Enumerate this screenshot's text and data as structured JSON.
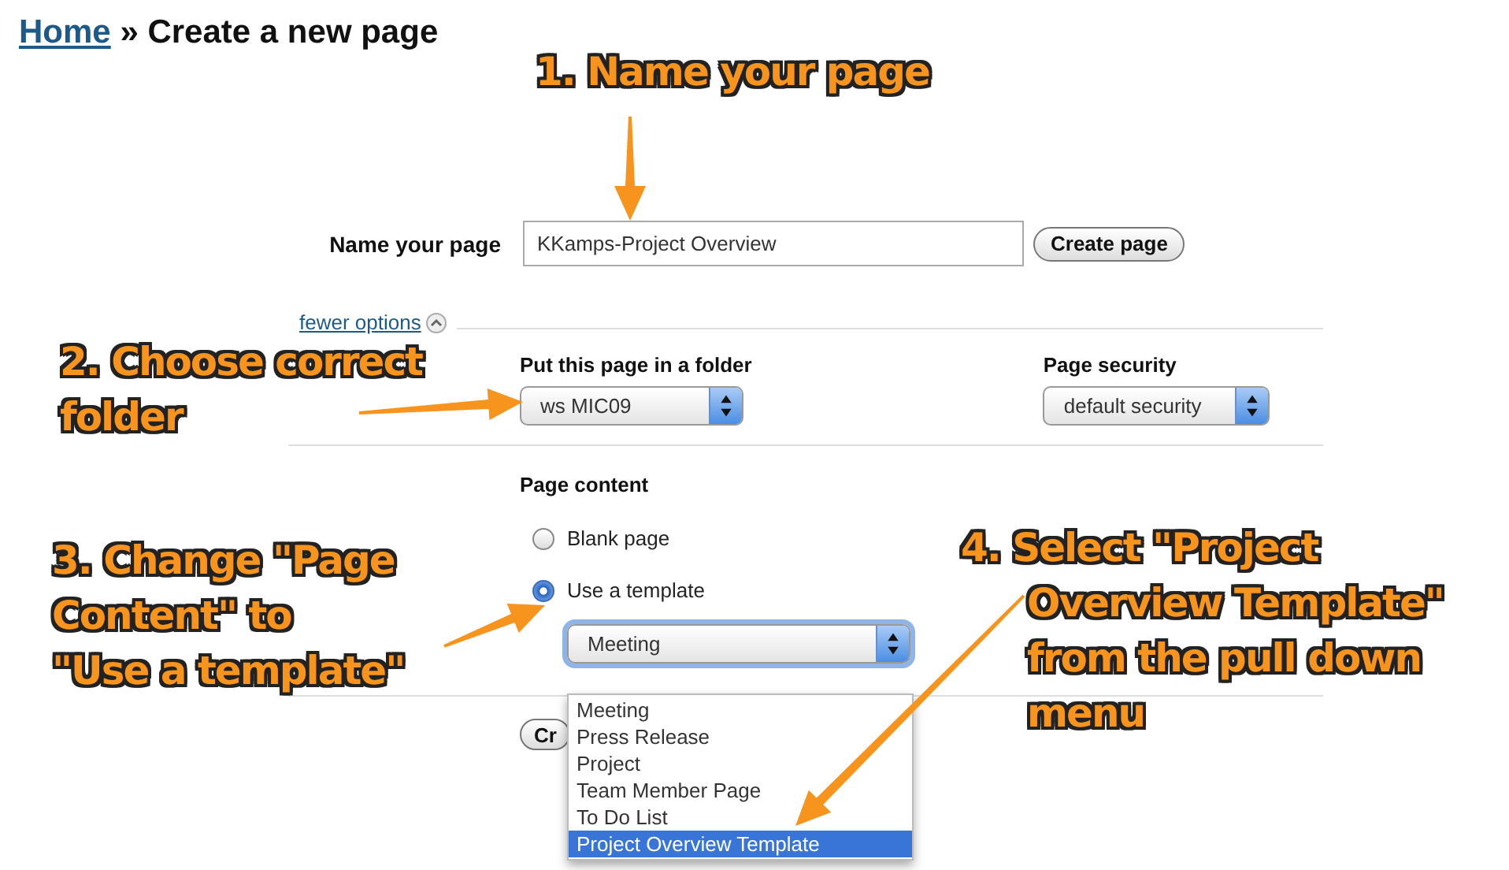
{
  "breadcrumb": {
    "link": "Home",
    "separator": "»",
    "current": "Create a new page"
  },
  "name_field": {
    "label": "Name your page",
    "value": "KKamps-Project Overview",
    "button": "Create page"
  },
  "options_link": {
    "label": "fewer options",
    "expanded": true
  },
  "folder": {
    "label": "Put this page in a folder",
    "value": "ws MIC09"
  },
  "security": {
    "label": "Page security",
    "value": "default security"
  },
  "page_content": {
    "label": "Page content",
    "options": [
      {
        "label": "Blank page",
        "selected": false
      },
      {
        "label": "Use a template",
        "selected": true
      }
    ],
    "template_select": {
      "value": "Meeting",
      "focused": true,
      "options": [
        {
          "label": "Meeting",
          "highlighted": false
        },
        {
          "label": "Press Release",
          "highlighted": false
        },
        {
          "label": "Project",
          "highlighted": false
        },
        {
          "label": "Team Member Page",
          "highlighted": false
        },
        {
          "label": "To Do List",
          "highlighted": false
        },
        {
          "label": "Project Overview Template",
          "highlighted": true
        }
      ]
    }
  },
  "submit_button": "Cr",
  "annotations": [
    {
      "lines": [
        "1. Name your page"
      ]
    },
    {
      "lines": [
        "2. Choose correct",
        "folder"
      ]
    },
    {
      "lines": [
        "3. Change \"Page",
        "Content\" to",
        "\"Use a template\""
      ]
    },
    {
      "lines": [
        "4. Select \"Project",
        "Overview Template\"",
        "from the pull down",
        "menu"
      ]
    }
  ]
}
